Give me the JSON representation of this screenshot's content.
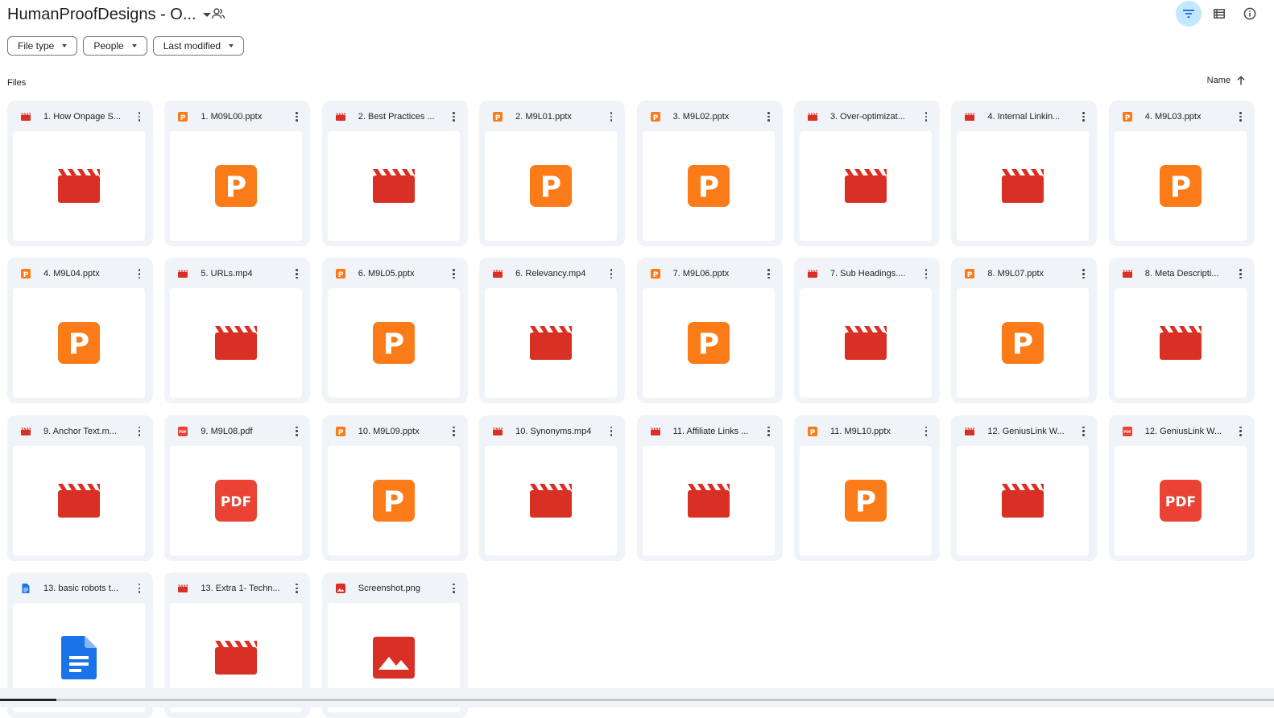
{
  "header": {
    "title": "HumanProofDesigns - O...",
    "shared_icon": "people-icon",
    "actions": [
      {
        "name": "filter-button",
        "icon": "filter-icon",
        "active": true
      },
      {
        "name": "list-view-button",
        "icon": "list-view-icon",
        "active": false
      },
      {
        "name": "details-button",
        "icon": "info-icon",
        "active": false
      }
    ]
  },
  "filters": [
    {
      "label": "File type"
    },
    {
      "label": "People"
    },
    {
      "label": "Last modified"
    }
  ],
  "section_label": "Files",
  "sort": {
    "label": "Name",
    "direction": "ascending",
    "icon": "arrow-up-icon"
  },
  "colors": {
    "video": "#d93025",
    "pptx": "#fa7b17",
    "pdf": "#ea4335",
    "doc": "#1a73e8",
    "image": "#d93025",
    "filter_active": "#c2e7ff",
    "card_bg": "#f0f4f9"
  },
  "files": [
    {
      "name": "1. How Onpage S...",
      "type": "video"
    },
    {
      "name": "1. M09L00.pptx",
      "type": "pptx"
    },
    {
      "name": "2. Best Practices ...",
      "type": "video"
    },
    {
      "name": "2. M9L01.pptx",
      "type": "pptx"
    },
    {
      "name": "3. M9L02.pptx",
      "type": "pptx"
    },
    {
      "name": "3. Over-optimizat...",
      "type": "video"
    },
    {
      "name": "4. Internal Linkin...",
      "type": "video"
    },
    {
      "name": "4. M9L03.pptx",
      "type": "pptx"
    },
    {
      "name": "4. M9L04.pptx",
      "type": "pptx"
    },
    {
      "name": "5. URLs.mp4",
      "type": "video"
    },
    {
      "name": "6. M9L05.pptx",
      "type": "pptx"
    },
    {
      "name": "6. Relevancy.mp4",
      "type": "video"
    },
    {
      "name": "7. M9L06.pptx",
      "type": "pptx"
    },
    {
      "name": "7. Sub Headings....",
      "type": "video"
    },
    {
      "name": "8. M9L07.pptx",
      "type": "pptx"
    },
    {
      "name": "8. Meta Descripti...",
      "type": "video"
    },
    {
      "name": "9. Anchor Text.m...",
      "type": "video"
    },
    {
      "name": "9. M9L08.pdf",
      "type": "pdf"
    },
    {
      "name": "10. M9L09.pptx",
      "type": "pptx"
    },
    {
      "name": "10. Synonyms.mp4",
      "type": "video"
    },
    {
      "name": "11. Affiliate Links ...",
      "type": "video"
    },
    {
      "name": "11. M9L10.pptx",
      "type": "pptx"
    },
    {
      "name": "12. GeniusLink W...",
      "type": "video"
    },
    {
      "name": "12. GeniusLink W...",
      "type": "pdf"
    },
    {
      "name": "13. basic robots t...",
      "type": "doc"
    },
    {
      "name": "13. Extra 1- Techn...",
      "type": "video"
    },
    {
      "name": "Screenshot.png",
      "type": "image"
    }
  ]
}
